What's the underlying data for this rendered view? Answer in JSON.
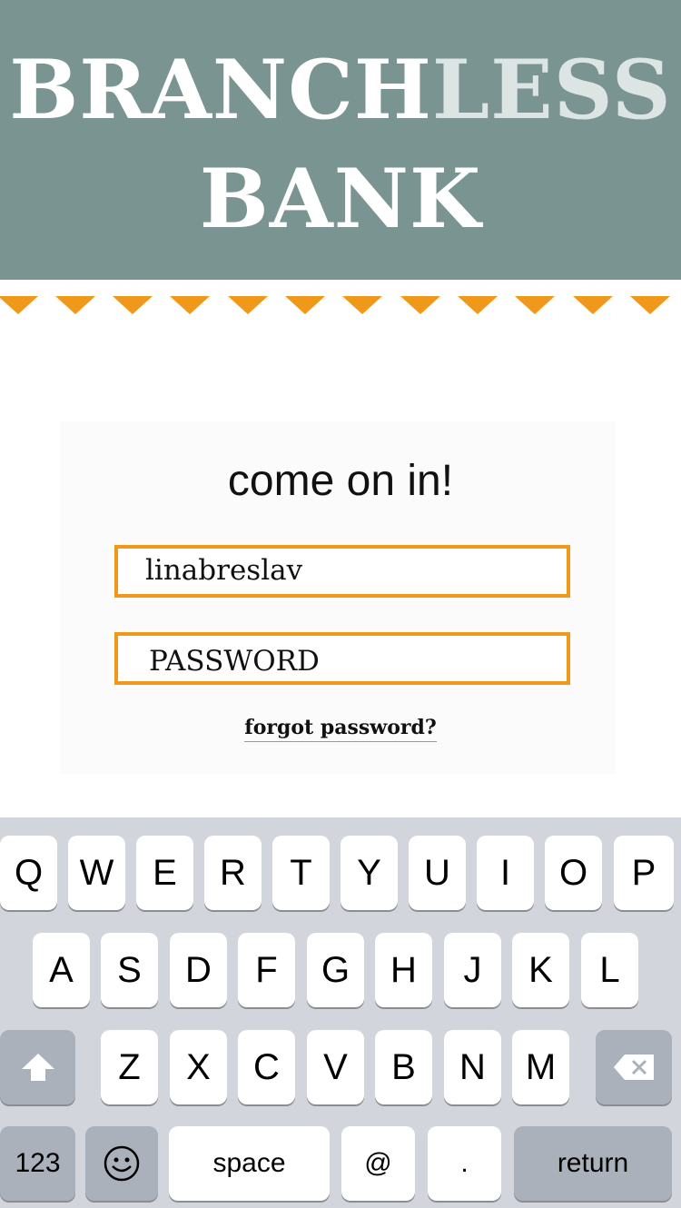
{
  "header": {
    "logo_part1": "BRANCH",
    "logo_part2": "LESS",
    "logo_line2": "BANK",
    "bg_color": "#7a9492",
    "accent_color": "#f0981a"
  },
  "login": {
    "title": "come on in!",
    "username_value": "linabreslav",
    "password_placeholder": "PASSWORD",
    "forgot_link": "forgot password?"
  },
  "keyboard": {
    "row1": [
      "Q",
      "W",
      "E",
      "R",
      "T",
      "Y",
      "U",
      "I",
      "O",
      "P"
    ],
    "row2": [
      "A",
      "S",
      "D",
      "F",
      "G",
      "H",
      "J",
      "K",
      "L"
    ],
    "row3": [
      "Z",
      "X",
      "C",
      "V",
      "B",
      "N",
      "M"
    ],
    "shift_icon": "shift-arrow-icon",
    "delete_icon": "backspace-icon",
    "numbers_label": "123",
    "emoji_icon": "emoji-icon",
    "space_label": "space",
    "at_label": "@",
    "dot_label": ".",
    "return_label": "return"
  }
}
